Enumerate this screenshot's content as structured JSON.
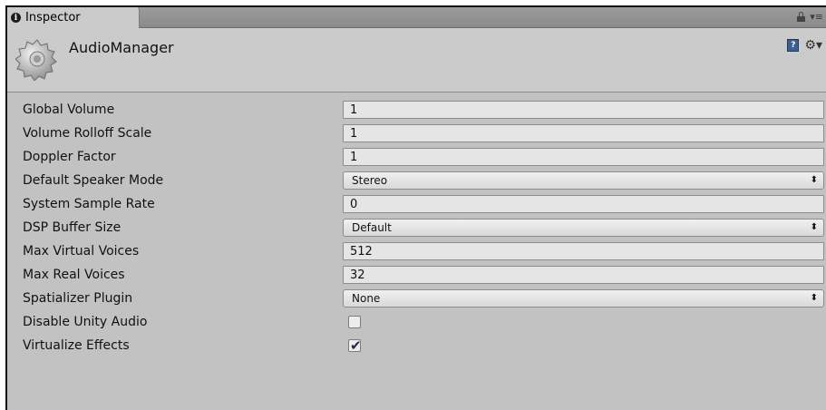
{
  "tab": {
    "title": "Inspector",
    "info_icon": "info-icon"
  },
  "header": {
    "title": "AudioManager",
    "help_icon": "help-icon",
    "settings_icon": "gear-icon"
  },
  "rows": [
    {
      "label": "Global Volume",
      "type": "field",
      "value": "1"
    },
    {
      "label": "Volume Rolloff Scale",
      "type": "field",
      "value": "1"
    },
    {
      "label": "Doppler Factor",
      "type": "field",
      "value": "1"
    },
    {
      "label": "Default Speaker Mode",
      "type": "select",
      "value": "Stereo"
    },
    {
      "label": "System Sample Rate",
      "type": "field",
      "value": "0"
    },
    {
      "label": "DSP Buffer Size",
      "type": "select",
      "value": "Default"
    },
    {
      "label": "Max Virtual Voices",
      "type": "field",
      "value": "512"
    },
    {
      "label": "Max Real Voices",
      "type": "field",
      "value": "32"
    },
    {
      "label": "Spatializer Plugin",
      "type": "select",
      "value": "None"
    },
    {
      "label": "Disable Unity Audio",
      "type": "checkbox",
      "checked": false
    },
    {
      "label": "Virtualize Effects",
      "type": "checkbox",
      "checked": true
    }
  ],
  "colors": {
    "panel": "#c2c2c2",
    "header": "#cbcbcb",
    "tabbar": "#8f8f8f"
  }
}
